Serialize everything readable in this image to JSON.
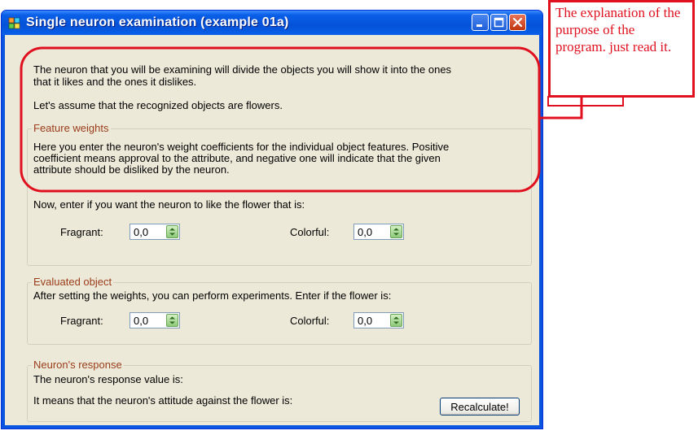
{
  "window": {
    "title": "Single neuron examination (example 01a)"
  },
  "intro": {
    "line1": "The neuron that you will be examining will divide the objects you will show it into the ones",
    "line2": "that it likes and the ones it dislikes.",
    "line3": "Let's assume that the recognized objects are flowers."
  },
  "weights": {
    "title": "Feature weights",
    "desc1": "Here you enter the neuron's weight coefficients for the individual object features. Positive",
    "desc2": "coefficient means approval to the attribute, and negative one will indicate that the given",
    "desc3": "attribute should be disliked by the neuron.",
    "prompt": "Now, enter if you want the neuron to like the flower that is:",
    "fragrant_label": "Fragrant:",
    "fragrant_value": "0,0",
    "colorful_label": "Colorful:",
    "colorful_value": "0,0"
  },
  "evaluated": {
    "title": "Evaluated object",
    "prompt": "After setting the weights, you can perform experiments. Enter if the flower is:",
    "fragrant_label": "Fragrant:",
    "fragrant_value": "0,0",
    "colorful_label": "Colorful:",
    "colorful_value": "0,0"
  },
  "response": {
    "title": "Neuron's response",
    "value_text": "The neuron's response value is:",
    "attitude_text": "It means that the neuron's attitude against the flower is:",
    "recalculate_label": "Recalculate!"
  },
  "annotation": {
    "text": "The explanation of the purpose of the program. just read it.",
    "color": "#e0101e"
  }
}
